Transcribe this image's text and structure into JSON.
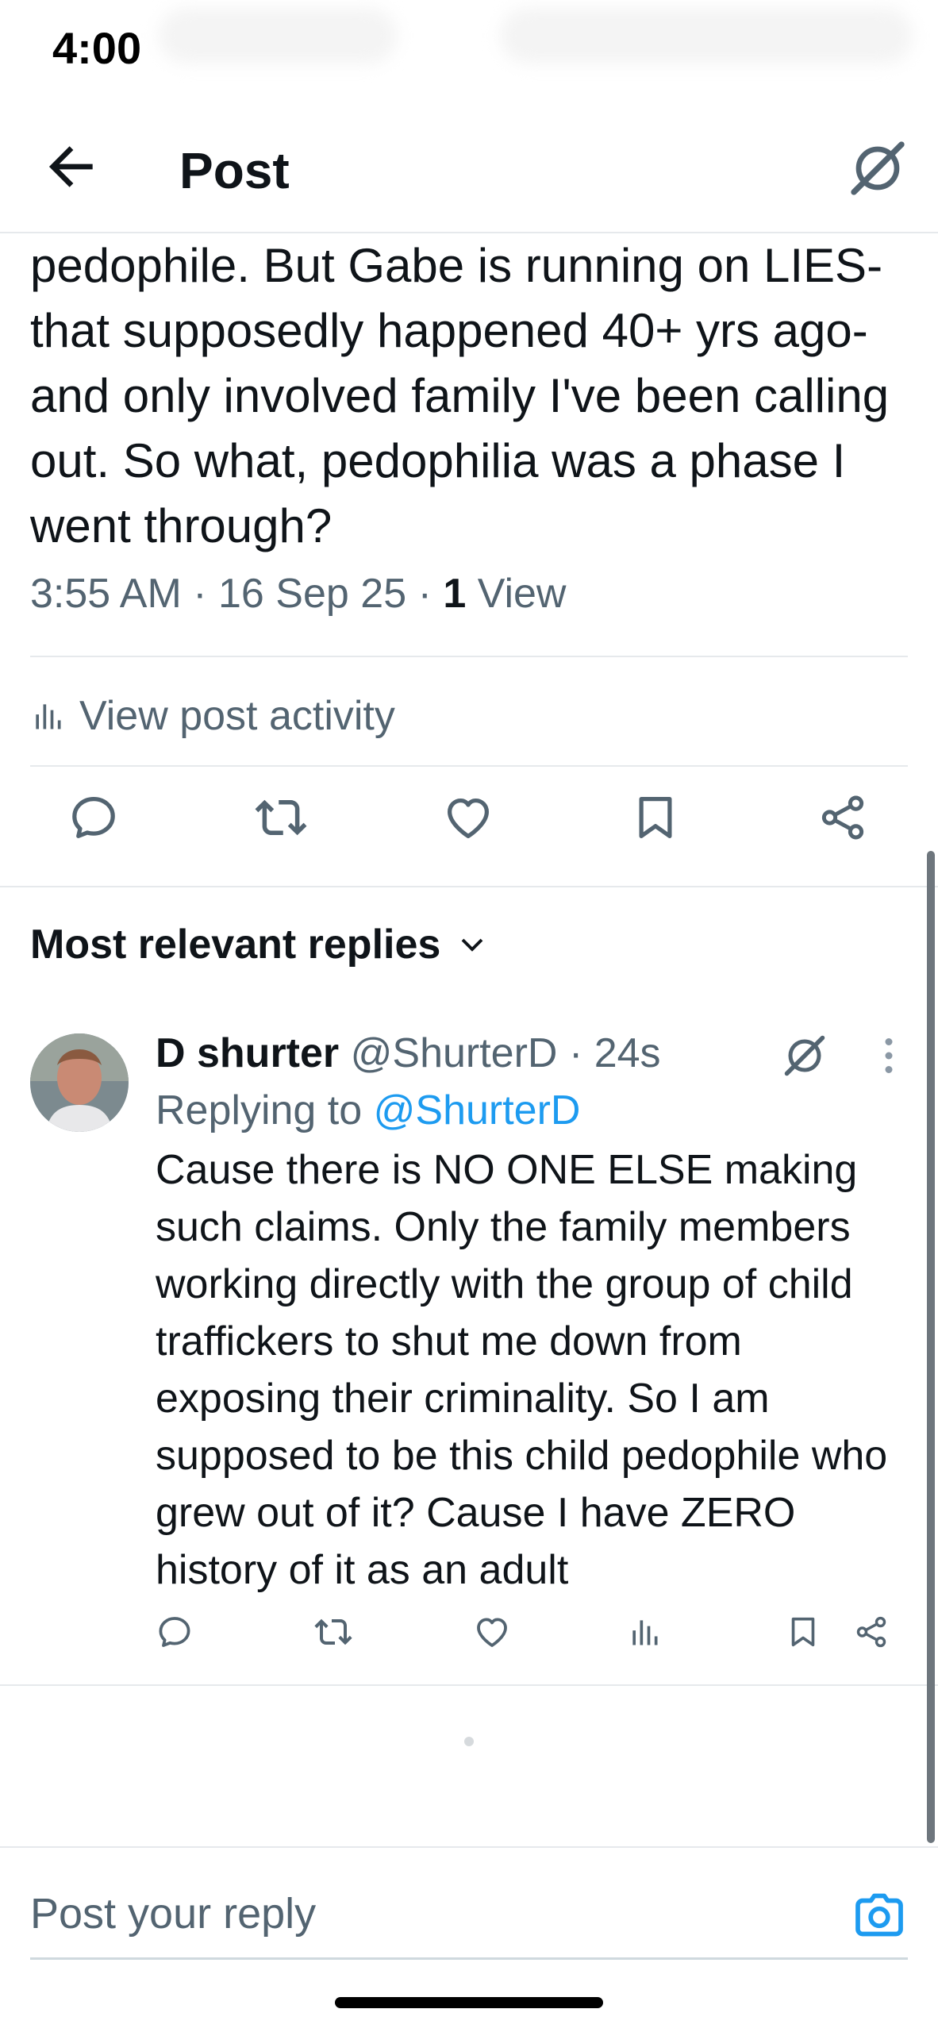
{
  "status_bar": {
    "time": "4:00"
  },
  "header": {
    "title": "Post",
    "back_icon": "arrow-left-icon",
    "grok_icon": "grok-icon"
  },
  "tweet": {
    "text": "pedophile. But Gabe is running on LIES- that supposedly happened 40+ yrs ago- and only involved family I've been calling out. So what, pedophilia was a phase I went through?",
    "time": "3:55 AM",
    "date": "16 Sep 25",
    "views_count": "1",
    "views_label": "View",
    "activity_label": "View post activity"
  },
  "actions": [
    "reply-icon",
    "repost-icon",
    "like-icon",
    "bookmark-icon",
    "share-icon"
  ],
  "replies_section": {
    "sort_label": "Most relevant replies"
  },
  "reply": {
    "name": "D shurter",
    "handle": "@ShurterD",
    "separator": "·",
    "age": "24s",
    "replying_prefix": "Replying to",
    "replying_handle": "@ShurterD",
    "text": "Cause there is NO ONE ELSE making such claims. Only the family members working directly with the group of child traffickers to shut me down from exposing their criminality. So I am supposed to be this child pedophile who grew out of it? Cause I have ZERO history of it as an adult"
  },
  "composer": {
    "placeholder": "Post your reply"
  },
  "colors": {
    "accent": "#1d9bf0",
    "text": "#0f1419",
    "muted": "#536471",
    "divider": "#e6e9ec"
  }
}
